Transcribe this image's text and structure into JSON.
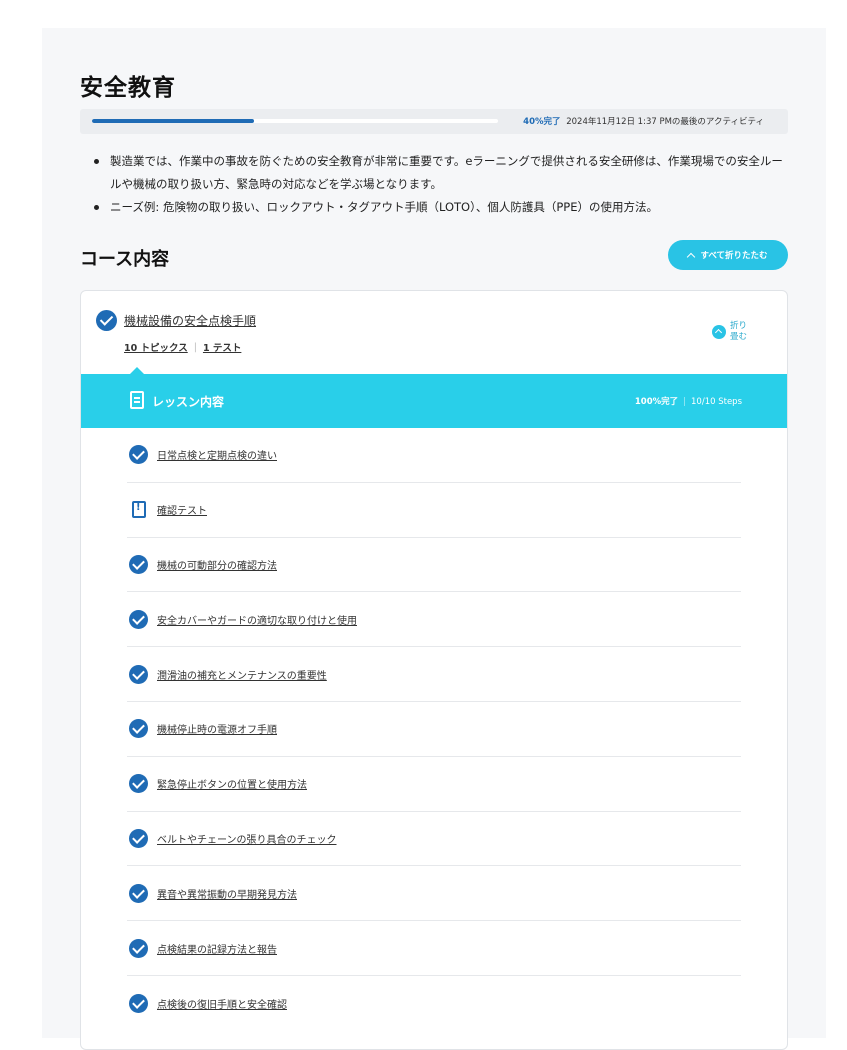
{
  "page": {
    "title": "安全教育"
  },
  "progress": {
    "percent": 40,
    "percent_label": "40%完了",
    "last_activity": "2024年11月12日 1:37 PMの最後のアクティビティ"
  },
  "description": {
    "items": [
      "製造業では、作業中の事故を防ぐための安全教育が非常に重要です。eラーニングで提供される安全研修は、作業現場での安全ルールや機械の取り扱い方、緊急時の対応などを学ぶ場となります。",
      "ニーズ例: 危険物の取り扱い、ロックアウト・タグアウト手順（LOTO）、個人防護具（PPE）の使用方法。"
    ]
  },
  "course_content": {
    "title": "コース内容",
    "collapse_all_label": "すべて折りたたむ"
  },
  "course": {
    "name": "機械設備の安全点検手順",
    "topics_count": "10 トピックス",
    "tests_count": "1 テスト",
    "collapse_label": "折り畳む",
    "lesson_bar": {
      "title": "レッスン内容",
      "percent_label": "100%完了",
      "steps": "10/10 Steps"
    },
    "topics": [
      {
        "label": "日常点検と定期点検の違い",
        "icon": "check-circle-icon"
      },
      {
        "label": "確認テスト",
        "icon": "quiz-icon"
      },
      {
        "label": "機械の可動部分の確認方法",
        "icon": "check-circle-icon"
      },
      {
        "label": "安全カバーやガードの適切な取り付けと使用",
        "icon": "check-circle-icon"
      },
      {
        "label": "潤滑油の補充とメンテナンスの重要性",
        "icon": "check-circle-icon"
      },
      {
        "label": "機械停止時の電源オフ手順",
        "icon": "check-circle-icon"
      },
      {
        "label": "緊急停止ボタンの位置と使用方法",
        "icon": "check-circle-icon"
      },
      {
        "label": "ベルトやチェーンの張り具合のチェック",
        "icon": "check-circle-icon"
      },
      {
        "label": "異音や異常振動の早期発見方法",
        "icon": "check-circle-icon"
      },
      {
        "label": "点検結果の記録方法と報告",
        "icon": "check-circle-icon"
      },
      {
        "label": "点検後の復旧手順と安全確認",
        "icon": "check-circle-icon"
      }
    ]
  },
  "colors": {
    "accent_blue": "#1f6bb5",
    "accent_cyan": "#29cfe9",
    "button_cyan": "#29c3e5"
  }
}
